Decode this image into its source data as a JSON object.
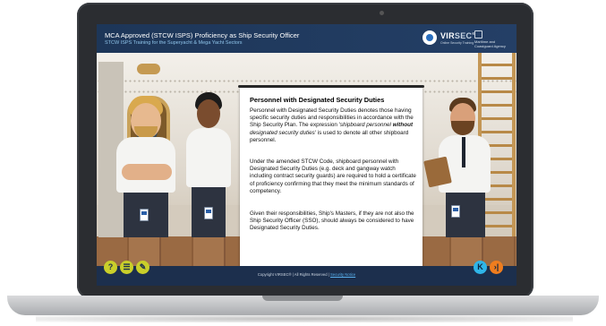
{
  "header": {
    "title": "MCA Approved (STCW ISPS) Proficiency as Ship Security Officer",
    "subtitle": "STCW ISPS Training for the Superyacht & Mega Yacht Sectors",
    "logo_vir": "VIR",
    "logo_sec": "SEC",
    "logo_reg": "®",
    "logo_tagline": "Online Security Training",
    "mca_text": "Maritime and Coastguard Agency"
  },
  "content": {
    "heading": "Personnel with Designated Security Duties",
    "paragraph1_part1": "Personnel with Designated Security Duties denotes those having specific security duties and responsibilities in accordance with the Ship Security Plan. The expression ",
    "paragraph1_italic": "'shipboard personnel ",
    "paragraph1_bold_italic": "without",
    "paragraph1_italic2": " designated security duties'",
    "paragraph1_part2": " is used to denote all other shipboard personnel.",
    "paragraph2": "Under the amended STCW Code, shipboard personnel with Designated Security Duties (e.g. deck and gangway watch including contract security guards) are required to hold a certificate of proficiency confirming that they meet the minimum standards of competency.",
    "paragraph3": "Given their responsibilities, Ship's Masters, if they are not also the Ship Security Officer (SSO), should always be considered to have Designated Security Duties."
  },
  "footer": {
    "copyright": "Copyright VIRSEC® | All Rights Reserved |",
    "link": "Security Notice",
    "help_label": "?",
    "menu_label": "☰",
    "notes_label": "✎",
    "prev_label": "K",
    "next_label": "›|"
  },
  "icons": {
    "help": "help-icon",
    "menu": "menu-list-icon",
    "notes": "pencil-icon",
    "prev": "previous-icon",
    "next": "next-icon"
  },
  "colors": {
    "header_bg": "#1d3658",
    "footer_bg": "#1c2f4d",
    "subtitle": "#8fc4ea",
    "lime_button": "#c9cf2a",
    "prev_button": "#2fb5e8",
    "next_button": "#f07d1e"
  }
}
